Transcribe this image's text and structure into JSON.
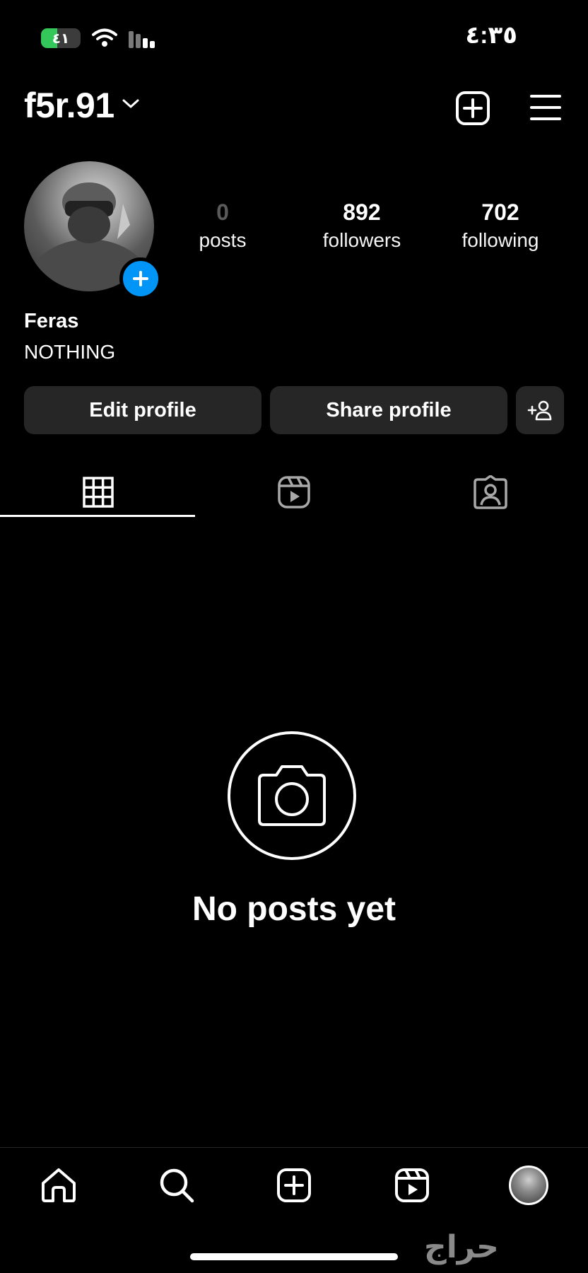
{
  "status_bar": {
    "time": "٤:٣٥",
    "battery": "٤١",
    "battery_level": 0.41
  },
  "header": {
    "username": "f5r.91"
  },
  "profile": {
    "display_name": "Feras",
    "bio": "NOTHING",
    "stats": [
      {
        "value": "0",
        "label": "posts"
      },
      {
        "value": "892",
        "label": "followers"
      },
      {
        "value": "702",
        "label": "following"
      }
    ]
  },
  "actions": {
    "edit_label": "Edit profile",
    "share_label": "Share profile"
  },
  "tabs": [
    "grid-icon",
    "reels-icon",
    "tagged-icon"
  ],
  "empty_state": {
    "title": "No posts yet"
  },
  "bottom_nav": [
    "home-icon",
    "search-icon",
    "create-icon",
    "reels-icon",
    "profile-avatar"
  ],
  "watermark": "حراج",
  "colors": {
    "accent": "#0095f6",
    "button_bg": "#262626",
    "background": "#000000",
    "battery_green": "#34c759"
  }
}
